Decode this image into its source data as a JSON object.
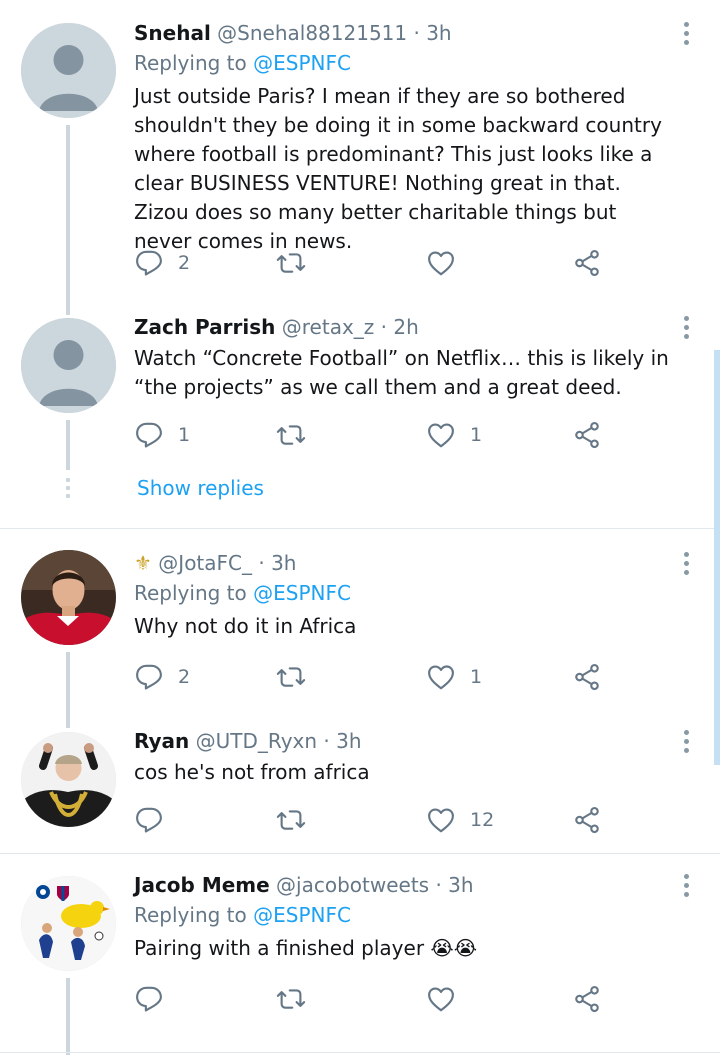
{
  "tweets": [
    {
      "name": "Snehal",
      "handle": "@Snehal88121511",
      "time": "· 3h",
      "replying_label": "Replying to",
      "replying_to": "@ESPNFC",
      "text": "Just outside Paris? I mean if they are so bothered shouldn't they be doing it in some backward country where football is predominant? This just looks like a clear BUSINESS VENTURE! Nothing great in that. Zizou does so many better charitable things but never comes in news.",
      "replies": "2",
      "retweets": "",
      "likes": ""
    },
    {
      "name": "Zach Parrish",
      "handle": "@retax_z",
      "time": "· 2h",
      "text": "Watch “Concrete Football” on Netflix… this is likely in “the projects” as we call them and a great deed.",
      "replies": "1",
      "retweets": "",
      "likes": "1",
      "show_replies": "Show replies"
    },
    {
      "name": "⚜",
      "handle": "@JotaFC_",
      "time": "· 3h",
      "replying_label": "Replying to",
      "replying_to": "@ESPNFC",
      "text": "Why not do it in Africa",
      "replies": "2",
      "retweets": "",
      "likes": "1"
    },
    {
      "name": "Ryan",
      "handle": "@UTD_Ryxn",
      "time": "· 3h",
      "text": "cos he's not from africa",
      "replies": "",
      "retweets": "",
      "likes": "12"
    },
    {
      "name": "Jacob Meme",
      "handle": "@jacobotweets",
      "time": "· 3h",
      "replying_label": "Replying to",
      "replying_to": "@ESPNFC",
      "text": "Pairing with a finished player 😭😭",
      "replies": "",
      "retweets": "",
      "likes": ""
    }
  ],
  "icons": {
    "reply": "reply-icon",
    "retweet": "retweet-icon",
    "like": "heart-icon",
    "share": "share-icon",
    "more": "more-vertical-icon"
  },
  "colors": {
    "link": "#1da1f2",
    "muted": "#657786",
    "divider": "#e1e8ed"
  }
}
